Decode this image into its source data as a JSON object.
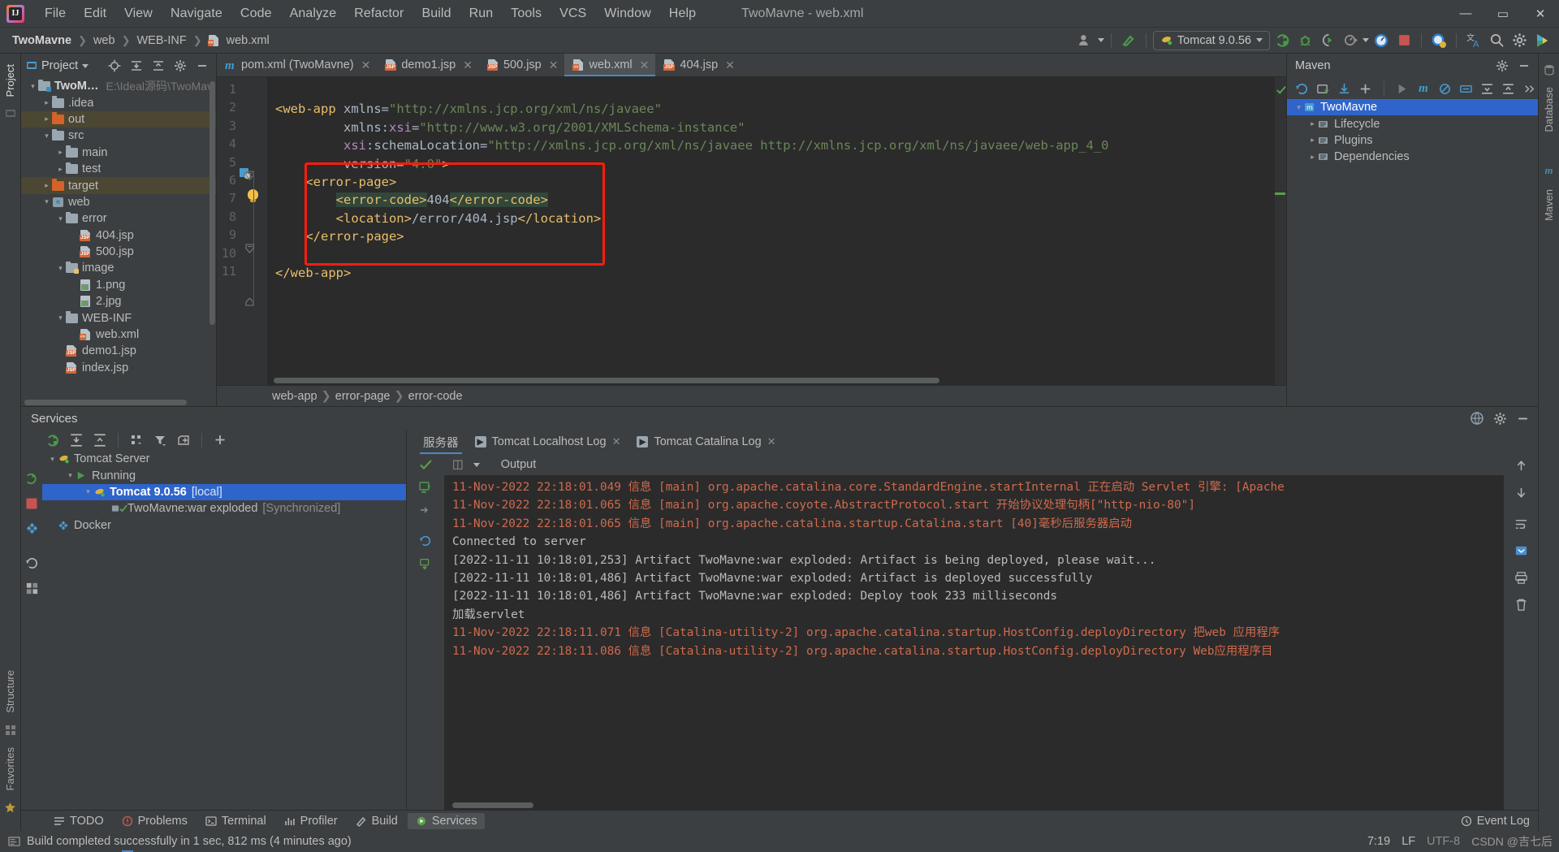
{
  "window": {
    "title": "TwoMavne - web.xml",
    "controls": {
      "minimize": "—",
      "maximize": "▭",
      "close": "✕"
    }
  },
  "menubar": {
    "items": [
      "File",
      "Edit",
      "View",
      "Navigate",
      "Code",
      "Analyze",
      "Refactor",
      "Build",
      "Run",
      "Tools",
      "VCS",
      "Window",
      "Help"
    ]
  },
  "navbar": {
    "breadcrumb": [
      "TwoMavne",
      "web",
      "WEB-INF",
      "web.xml"
    ],
    "run_config": "Tomcat 9.0.56",
    "icons": [
      "user-avatar-icon",
      "hammer-icon",
      "run-icon",
      "debug-icon",
      "run-coverage-icon",
      "profiler-icon",
      "stop-icon",
      "tomcat-deploy-icon",
      "translate-icon",
      "search-everywhere-icon",
      "settings-icon",
      "ide-features-icon"
    ]
  },
  "left_strip": {
    "tabs": [
      "Project",
      "Structure",
      "Favorites"
    ]
  },
  "right_strip": {
    "tabs": [
      "Database",
      "Maven"
    ]
  },
  "project_panel": {
    "title": "Project",
    "actions": [
      "locate-icon",
      "expand-all-icon",
      "collapse-all-icon",
      "settings-icon",
      "hide-icon"
    ],
    "tree": [
      {
        "label": "TwoMavne",
        "path": "E:\\Ideal源码\\TwoMav",
        "depth": 0,
        "icon": "project-folder",
        "expanded": true,
        "bold": true,
        "highlight": "none"
      },
      {
        "label": ".idea",
        "path": "",
        "depth": 1,
        "icon": "folder",
        "expanded": false,
        "bold": false,
        "highlight": "none"
      },
      {
        "label": "out",
        "path": "",
        "depth": 1,
        "icon": "folder-orange",
        "expanded": false,
        "bold": false,
        "highlight": "excluded"
      },
      {
        "label": "src",
        "path": "",
        "depth": 1,
        "icon": "folder",
        "expanded": true,
        "bold": false,
        "highlight": "none"
      },
      {
        "label": "main",
        "path": "",
        "depth": 2,
        "icon": "folder",
        "expanded": false,
        "bold": false,
        "highlight": "none"
      },
      {
        "label": "test",
        "path": "",
        "depth": 2,
        "icon": "folder",
        "expanded": false,
        "bold": false,
        "highlight": "none"
      },
      {
        "label": "target",
        "path": "",
        "depth": 1,
        "icon": "folder-orange",
        "expanded": false,
        "bold": false,
        "highlight": "excluded"
      },
      {
        "label": "web",
        "path": "",
        "depth": 1,
        "icon": "web-module",
        "expanded": true,
        "bold": false,
        "highlight": "none"
      },
      {
        "label": "error",
        "path": "",
        "depth": 2,
        "icon": "folder",
        "expanded": true,
        "bold": false,
        "highlight": "none"
      },
      {
        "label": "404.jsp",
        "path": "",
        "depth": 3,
        "icon": "jsp-file",
        "expanded": null,
        "bold": false,
        "highlight": "none"
      },
      {
        "label": "500.jsp",
        "path": "",
        "depth": 3,
        "icon": "jsp-file",
        "expanded": null,
        "bold": false,
        "highlight": "none"
      },
      {
        "label": "image",
        "path": "",
        "depth": 2,
        "icon": "folder-resource",
        "expanded": true,
        "bold": false,
        "highlight": "none"
      },
      {
        "label": "1.png",
        "path": "",
        "depth": 3,
        "icon": "image-file",
        "expanded": null,
        "bold": false,
        "highlight": "none"
      },
      {
        "label": "2.jpg",
        "path": "",
        "depth": 3,
        "icon": "image-file",
        "expanded": null,
        "bold": false,
        "highlight": "none"
      },
      {
        "label": "WEB-INF",
        "path": "",
        "depth": 2,
        "icon": "folder",
        "expanded": true,
        "bold": false,
        "highlight": "none"
      },
      {
        "label": "web.xml",
        "path": "",
        "depth": 3,
        "icon": "xml-file",
        "expanded": null,
        "bold": false,
        "highlight": "none"
      },
      {
        "label": "demo1.jsp",
        "path": "",
        "depth": 2,
        "icon": "jsp-file",
        "expanded": null,
        "bold": false,
        "highlight": "none"
      },
      {
        "label": "index.jsp",
        "path": "",
        "depth": 2,
        "icon": "jsp-file",
        "expanded": null,
        "bold": false,
        "highlight": "none"
      }
    ]
  },
  "editor": {
    "tabs": [
      {
        "label": "pom.xml (TwoMavne)",
        "icon": "maven-m-icon",
        "active": false
      },
      {
        "label": "demo1.jsp",
        "icon": "jsp-file",
        "active": false
      },
      {
        "label": "500.jsp",
        "icon": "jsp-file",
        "active": false
      },
      {
        "label": "web.xml",
        "icon": "xml-file",
        "active": true
      },
      {
        "label": "404.jsp",
        "icon": "jsp-file",
        "active": false
      }
    ],
    "line_numbers": [
      "1",
      "2",
      "3",
      "4",
      "5",
      "6",
      "7",
      "8",
      "9",
      "10",
      "11"
    ],
    "code_lines": [
      {
        "n": 1,
        "segments": []
      },
      {
        "n": 2,
        "segments": [
          {
            "t": "<web-app",
            "c": "k-tag"
          },
          {
            "t": " xmlns=",
            "c": "k-txt"
          },
          {
            "t": "\"http://xmlns.jcp.org/xml/ns/javaee\"",
            "c": "k-str"
          }
        ]
      },
      {
        "n": 3,
        "segments": [
          {
            "t": "         xmlns:",
            "c": "k-txt"
          },
          {
            "t": "xsi",
            "c": "k-ns"
          },
          {
            "t": "=",
            "c": "k-txt"
          },
          {
            "t": "\"http://www.w3.org/2001/XMLSchema-instance\"",
            "c": "k-str"
          }
        ]
      },
      {
        "n": 4,
        "segments": [
          {
            "t": "         ",
            "c": "k-txt"
          },
          {
            "t": "xsi",
            "c": "k-ns"
          },
          {
            "t": ":schemaLocation=",
            "c": "k-txt"
          },
          {
            "t": "\"http://xmlns.jcp.org/xml/ns/javaee http://xmlns.jcp.org/xml/ns/javaee/web-app_4_0",
            "c": "k-str"
          }
        ]
      },
      {
        "n": 5,
        "segments": [
          {
            "t": "         version=",
            "c": "k-txt"
          },
          {
            "t": "\"4.0\"",
            "c": "k-str"
          },
          {
            "t": ">",
            "c": "k-tag"
          }
        ]
      },
      {
        "n": 6,
        "segments": [
          {
            "t": "    <error-page>",
            "c": "k-tag"
          }
        ]
      },
      {
        "n": 7,
        "segments": [
          {
            "t": "        ",
            "c": "k-txt"
          },
          {
            "t": "<error-code>",
            "c": "k-tag hl-soft"
          },
          {
            "t": "404",
            "c": "k-val"
          },
          {
            "t": "</error-code>",
            "c": "k-tag hl-soft"
          }
        ]
      },
      {
        "n": 8,
        "segments": [
          {
            "t": "        ",
            "c": "k-txt"
          },
          {
            "t": "<location>",
            "c": "k-tag"
          },
          {
            "t": "/error/404.jsp",
            "c": "k-txt"
          },
          {
            "t": "</location>",
            "c": "k-tag"
          }
        ]
      },
      {
        "n": 9,
        "segments": [
          {
            "t": "    </error-page>",
            "c": "k-tag"
          }
        ]
      },
      {
        "n": 10,
        "segments": []
      },
      {
        "n": 11,
        "segments": [
          {
            "t": "</web-app>",
            "c": "k-tag"
          }
        ]
      }
    ],
    "breadcrumb": [
      "web-app",
      "error-page",
      "error-code"
    ],
    "inspection_status": "ok-check"
  },
  "maven_panel": {
    "title": "Maven",
    "actions": [
      "reload-icon",
      "add-icon",
      "download-icon",
      "plus-icon",
      "run-icon",
      "maven-icon",
      "skip-tests-icon",
      "toggle-offline-icon",
      "expand-icon",
      "collapse-icon",
      "more-icon",
      "settings-icon",
      "hide-icon"
    ],
    "tree": [
      {
        "label": "TwoMavne",
        "depth": 0,
        "expanded": true,
        "selected": true,
        "icon": "maven-project-icon"
      },
      {
        "label": "Lifecycle",
        "depth": 1,
        "expanded": false,
        "selected": false,
        "icon": "lifecycle-icon"
      },
      {
        "label": "Plugins",
        "depth": 1,
        "expanded": false,
        "selected": false,
        "icon": "plugins-icon"
      },
      {
        "label": "Dependencies",
        "depth": 1,
        "expanded": false,
        "selected": false,
        "icon": "dependencies-icon"
      }
    ]
  },
  "services": {
    "title": "Services",
    "toolbar_icons": [
      "rerun-icon",
      "expand-all-icon",
      "collapse-all-icon",
      "group-icon",
      "filter-icon",
      "add-tab-icon",
      "add-icon"
    ],
    "side_icons": [
      "rerun-icon",
      "stop-icon",
      "docker-icon",
      "refresh-icon",
      "layout-icon"
    ],
    "tree": [
      {
        "label": "Tomcat Server",
        "extra": "",
        "depth": 0,
        "expanded": true,
        "selected": false,
        "icon": "tomcat-icon"
      },
      {
        "label": "Running",
        "extra": "",
        "depth": 1,
        "expanded": true,
        "selected": false,
        "icon": "run-green-icon"
      },
      {
        "label": "Tomcat 9.0.56",
        "extra": "[local]",
        "depth": 2,
        "expanded": true,
        "selected": true,
        "icon": "tomcat-icon"
      },
      {
        "label": "TwoMavne:war exploded",
        "extra": "[Synchronized]",
        "depth": 3,
        "expanded": null,
        "selected": false,
        "icon": "artifact-ok-icon"
      },
      {
        "label": "Docker",
        "extra": "",
        "depth": 0,
        "expanded": null,
        "selected": false,
        "icon": "docker-icon"
      }
    ],
    "console_tabs": [
      {
        "label": "服务器",
        "icon": "",
        "active": true,
        "closable": false
      },
      {
        "label": "Tomcat Localhost Log",
        "icon": "run-sq-icon",
        "active": false,
        "closable": true
      },
      {
        "label": "Tomcat Catalina Log",
        "icon": "run-sq-icon",
        "active": false,
        "closable": true
      }
    ],
    "console_header": "Output",
    "log_lines": [
      {
        "text": "11-Nov-2022 22:18:01.049 信息 [main] org.apache.catalina.core.StandardEngine.startInternal 正在启动 Servlet 引擎: [Apache",
        "color": "red"
      },
      {
        "text": "11-Nov-2022 22:18:01.065 信息 [main] org.apache.coyote.AbstractProtocol.start 开始协议处理句柄[\"http-nio-80\"]",
        "color": "red"
      },
      {
        "text": "11-Nov-2022 22:18:01.065 信息 [main] org.apache.catalina.startup.Catalina.start [40]毫秒后服务器启动",
        "color": "red"
      },
      {
        "text": "Connected to server",
        "color": "white"
      },
      {
        "text": "[2022-11-11 10:18:01,253] Artifact TwoMavne:war exploded: Artifact is being deployed, please wait...",
        "color": "white"
      },
      {
        "text": "[2022-11-11 10:18:01,486] Artifact TwoMavne:war exploded: Artifact is deployed successfully",
        "color": "white"
      },
      {
        "text": "[2022-11-11 10:18:01,486] Artifact TwoMavne:war exploded: Deploy took 233 milliseconds",
        "color": "white"
      },
      {
        "text": "加载servlet",
        "color": "white"
      },
      {
        "text": "11-Nov-2022 22:18:11.071 信息 [Catalina-utility-2] org.apache.catalina.startup.HostConfig.deployDirectory 把web 应用程序",
        "color": "red"
      },
      {
        "text": "11-Nov-2022 22:18:11.086 信息 [Catalina-utility-2] org.apache.catalina.startup.HostConfig.deployDirectory Web应用程序目",
        "color": "red"
      }
    ],
    "console_side_icons": [
      "scroll-up-icon",
      "scroll-down-icon",
      "soft-wrap-icon",
      "scroll-end-icon",
      "print-icon",
      "clear-all-icon"
    ]
  },
  "toolwindow_bar": {
    "items": [
      {
        "label": "TODO",
        "icon": "todo-icon",
        "active": false
      },
      {
        "label": "Problems",
        "icon": "problems-icon",
        "active": false
      },
      {
        "label": "Terminal",
        "icon": "terminal-icon",
        "active": false
      },
      {
        "label": "Profiler",
        "icon": "profiler-icon",
        "active": false
      },
      {
        "label": "Build",
        "icon": "build-icon",
        "active": false
      },
      {
        "label": "Services",
        "icon": "services-icon",
        "active": true
      }
    ],
    "event_log": "Event Log"
  },
  "statusbar": {
    "message": "Build completed successfully in 1 sec, 812 ms (4 minutes ago)",
    "caret": "7:19",
    "line_sep": "LF",
    "encoding": "UTF-8",
    "watermark": "CSDN @吉七后"
  }
}
